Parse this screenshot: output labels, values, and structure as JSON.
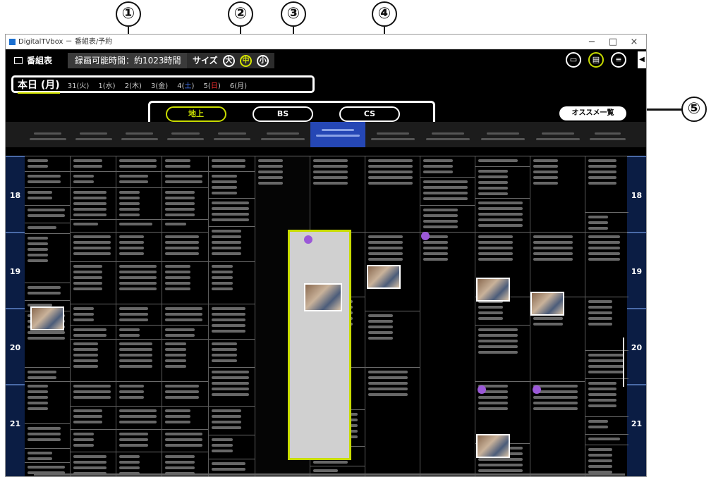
{
  "callouts": [
    "①",
    "②",
    "③",
    "④",
    "⑤"
  ],
  "window": {
    "title": "DigitalTVbox － 番組表/予約",
    "controls": {
      "minimize": "−",
      "maximize": "□",
      "close": "×"
    }
  },
  "toolbar": {
    "program_guide": "番組表",
    "remaining_time": "録画可能時間：約1023時間",
    "size_label": "サイズ",
    "size_options": [
      "大",
      "中",
      "小"
    ],
    "size_selected": "中",
    "right_icons": [
      "tv-icon",
      "guide-icon",
      "playlist-icon"
    ],
    "nav_arrow": "◀"
  },
  "dates": {
    "today": "本日 (月)",
    "days": [
      {
        "num": "31",
        "dow": "(火)"
      },
      {
        "num": "1",
        "dow": "(水)"
      },
      {
        "num": "2",
        "dow": "(木)"
      },
      {
        "num": "3",
        "dow": "(金)"
      },
      {
        "num": "4",
        "open": "(",
        "dow": "土",
        "close": ")",
        "type": "sat"
      },
      {
        "num": "5",
        "open": "(",
        "dow": "日",
        "close": ")",
        "type": "sun"
      },
      {
        "num": "6",
        "dow": "(月)"
      }
    ]
  },
  "bands": {
    "items": [
      "地上",
      "BS",
      "CS"
    ],
    "selected": "地上"
  },
  "recommend": "オススメ一覧",
  "hours": [
    "18",
    "19",
    "20",
    "21"
  ],
  "colors": {
    "accent": "#c8dc00",
    "selected_channel": "#2547b5",
    "time_column": "#0b1d44",
    "saturday": "#4a7dff",
    "sunday": "#ff3030",
    "badge": "#9b58d8"
  }
}
